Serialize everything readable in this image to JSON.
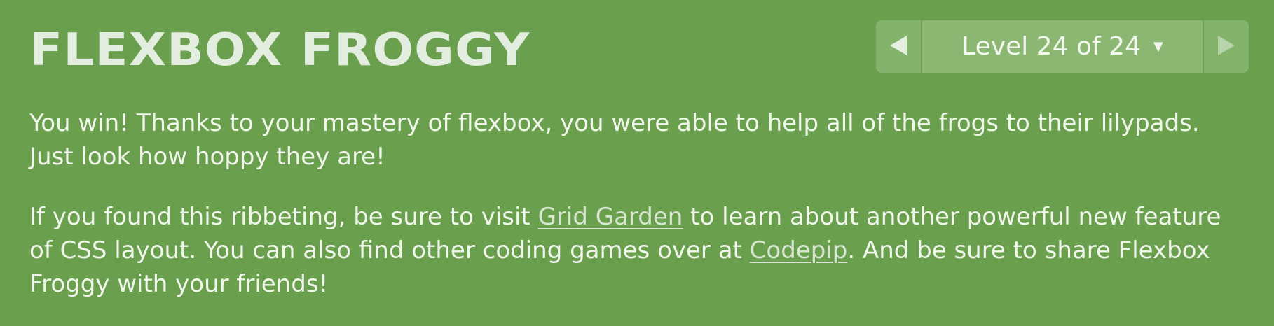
{
  "header": {
    "title": "FLEXBOX FROGGY"
  },
  "level_nav": {
    "prev_icon": "triangle-left-icon",
    "next_icon": "triangle-right-icon",
    "level_label": "Level 24 of 24",
    "dropdown_icon": "caret-down-icon"
  },
  "content": {
    "paragraph1": "You win! Thanks to your mastery of flexbox, you were able to help all of the frogs to their lilypads. Just look how hoppy they are!",
    "paragraph2": {
      "text_before_link1": "If you found this ribbeting, be sure to visit ",
      "link1": "Grid Garden",
      "text_between_links": " to learn about another powerful new feature of CSS layout. You can also find other coding games over at ",
      "link2": "Codepip",
      "text_after_link2": ". And be sure to share Flexbox Froggy with your friends!"
    }
  },
  "colors": {
    "background": "#6aa04d",
    "nav_arrow_bg": "#84b36b",
    "level_bg": "#8bb773",
    "title_text": "#e3ede0"
  }
}
